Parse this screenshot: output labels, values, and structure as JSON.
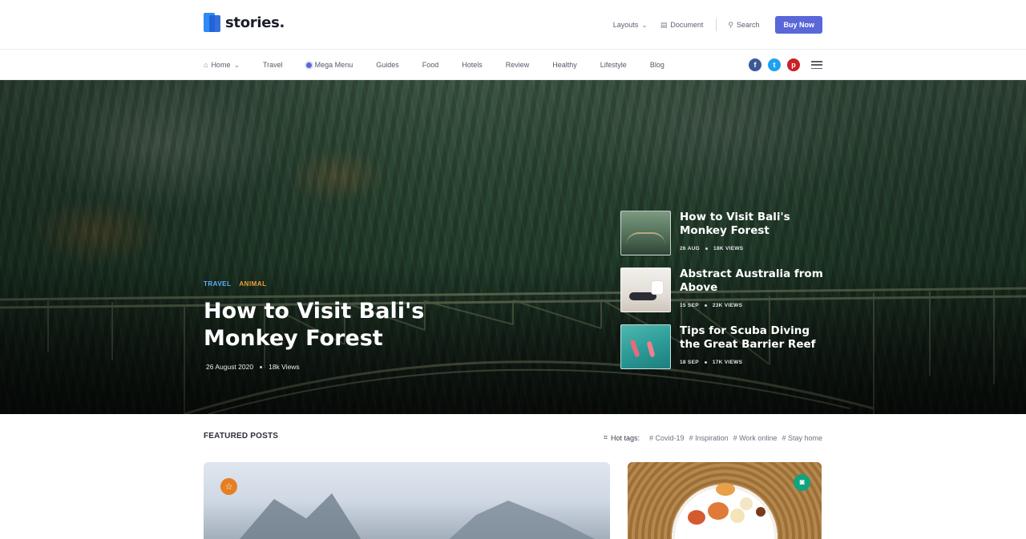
{
  "brand": {
    "name": "stories."
  },
  "top_nav": {
    "layouts": "Layouts",
    "document": "Document",
    "search": "Search",
    "buy_now": "Buy Now"
  },
  "main_nav": {
    "items": [
      {
        "label": "Home",
        "icon": "home-icon"
      },
      {
        "label": "Travel"
      },
      {
        "label": "Mega Menu",
        "icon": "dot-icon"
      },
      {
        "label": "Guides"
      },
      {
        "label": "Food"
      },
      {
        "label": "Hotels"
      },
      {
        "label": "Review"
      },
      {
        "label": "Healthy"
      },
      {
        "label": "Lifestyle"
      },
      {
        "label": "Blog"
      }
    ],
    "social": [
      "facebook",
      "twitter",
      "pinterest"
    ]
  },
  "hero": {
    "tags": [
      "TRAVEL",
      "ANIMAL"
    ],
    "title": "How to Visit Bali's Monkey Forest",
    "date": "26 August 2020",
    "views": "18k Views",
    "side_posts": [
      {
        "title": "How to Visit Bali's Monkey Forest",
        "date": "26 AUG",
        "views": "18K VIEWS"
      },
      {
        "title": "Abstract Australia from Above",
        "date": "15 SEP",
        "views": "23K VIEWS"
      },
      {
        "title": "Tips for Scuba Diving the Great Barrier Reef",
        "date": "18 SEP",
        "views": "17K VIEWS"
      }
    ]
  },
  "featured": {
    "heading": "FEATURED POSTS",
    "hot_tags_label": "Hot tags:",
    "hot_tags": [
      "# Covid-19",
      "# Inspiration",
      "# Work online",
      "# Stay home"
    ]
  },
  "colors": {
    "accent": "#5a67d8",
    "tag_travel": "#5fb2ff",
    "tag_animal": "#f0a13c",
    "badge_star": "#e67e22",
    "badge_camera": "#10a37f"
  }
}
